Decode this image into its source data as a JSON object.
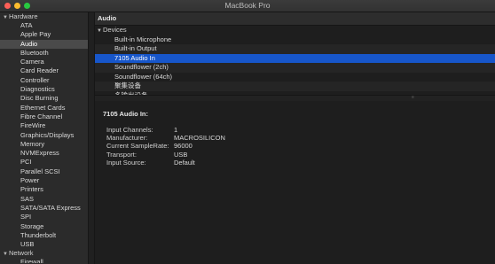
{
  "window": {
    "title": "MacBook Pro"
  },
  "sidebar": {
    "groups": [
      {
        "label": "Hardware",
        "items": [
          "ATA",
          "Apple Pay",
          "Audio",
          "Bluetooth",
          "Camera",
          "Card Reader",
          "Controller",
          "Diagnostics",
          "Disc Burning",
          "Ethernet Cards",
          "Fibre Channel",
          "FireWire",
          "Graphics/Displays",
          "Memory",
          "NVMExpress",
          "PCI",
          "Parallel SCSI",
          "Power",
          "Printers",
          "SAS",
          "SATA/SATA Express",
          "SPI",
          "Storage",
          "Thunderbolt",
          "USB"
        ],
        "selected": "Audio"
      },
      {
        "label": "Network",
        "items": [
          "Firewall"
        ]
      }
    ]
  },
  "main": {
    "column_header": "Audio",
    "devices_group": "Devices",
    "devices": [
      "Built-in Microphone",
      "Built-in Output",
      "7105 Audio In",
      "Soundflower (2ch)",
      "Soundflower (64ch)",
      "聚集设备",
      "多输出设备"
    ],
    "selected_device": "7105 Audio In",
    "detail": {
      "title": "7105 Audio In:",
      "fields": [
        {
          "key": "Input Channels:",
          "value": "1"
        },
        {
          "key": "Manufacturer:",
          "value": "MACROSILICON"
        },
        {
          "key": "Current SampleRate:",
          "value": "96000"
        },
        {
          "key": "Transport:",
          "value": "USB"
        },
        {
          "key": "Input Source:",
          "value": "Default"
        }
      ]
    }
  },
  "colors": {
    "selection_blue": "#1756ca",
    "sidebar_selection": "#4a4a4a",
    "close": "#fc5f57",
    "minimize": "#fdbc2e",
    "maximize": "#28c840"
  }
}
